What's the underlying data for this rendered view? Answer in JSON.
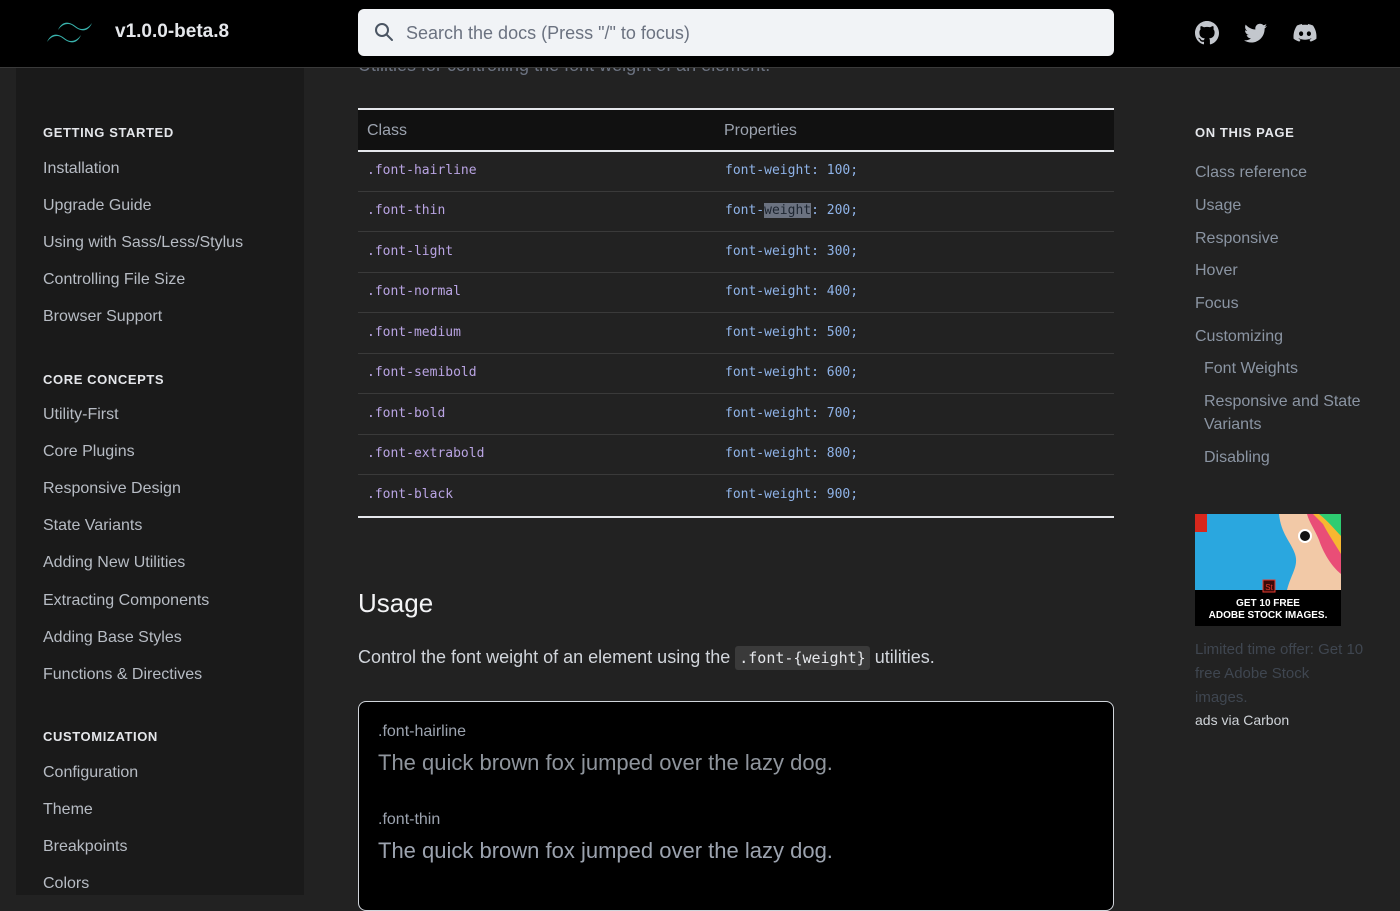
{
  "header": {
    "version": "v1.0.0-beta.8",
    "search_placeholder": "Search the docs (Press \"/\" to focus)",
    "social_icons": [
      "github-icon",
      "twitter-icon",
      "discord-icon"
    ]
  },
  "sidebar": {
    "sections": [
      {
        "title": "GETTING STARTED",
        "items": [
          "Installation",
          "Upgrade Guide",
          "Using with Sass/Less/Stylus",
          "Controlling File Size",
          "Browser Support"
        ]
      },
      {
        "title": "CORE CONCEPTS",
        "items": [
          "Utility-First",
          "Core Plugins",
          "Responsive Design",
          "State Variants",
          "Adding New Utilities",
          "Extracting Components",
          "Adding Base Styles",
          "Functions & Directives"
        ]
      },
      {
        "title": "CUSTOMIZATION",
        "items": [
          "Configuration",
          "Theme",
          "Breakpoints",
          "Colors"
        ]
      }
    ]
  },
  "main": {
    "subtitle": "Utilities for controlling the font weight of an element.",
    "table": {
      "headers": [
        "Class",
        "Properties"
      ],
      "rows": [
        {
          "cls": ".font-hairline",
          "prop": "font-weight: 100;"
        },
        {
          "cls": ".font-thin",
          "prop_a": "font-",
          "prop_hl": "weight",
          "prop_b": ": 200;"
        },
        {
          "cls": ".font-light",
          "prop": "font-weight: 300;"
        },
        {
          "cls": ".font-normal",
          "prop": "font-weight: 400;"
        },
        {
          "cls": ".font-medium",
          "prop": "font-weight: 500;"
        },
        {
          "cls": ".font-semibold",
          "prop": "font-weight: 600;"
        },
        {
          "cls": ".font-bold",
          "prop": "font-weight: 700;"
        },
        {
          "cls": ".font-extrabold",
          "prop": "font-weight: 800;"
        },
        {
          "cls": ".font-black",
          "prop": "font-weight: 900;"
        }
      ]
    },
    "usage": {
      "heading": "Usage",
      "text_before": "Control the font weight of an element using the ",
      "code": ".font-{weight}",
      "text_after": " utilities."
    },
    "demo": {
      "examples": [
        {
          "label": ".font-hairline",
          "text": "The quick brown fox jumped over the lazy dog."
        },
        {
          "label": ".font-thin",
          "text": "The quick brown fox jumped over the lazy dog."
        }
      ]
    }
  },
  "toc": {
    "title": "ON THIS PAGE",
    "items": [
      "Class reference",
      "Usage",
      "Responsive",
      "Hover",
      "Focus",
      "Customizing"
    ],
    "sub_items": [
      "Font Weights",
      "Responsive and State",
      "Variants",
      "Disabling"
    ]
  },
  "ad": {
    "headline_1": "GET 10 FREE",
    "headline_2": "ADOBE STOCK IMAGES.",
    "text": "Limited time offer: Get 10 free Adobe Stock images.",
    "via": "ads via Carbon"
  },
  "colors": {
    "accent_teal": "#38b2ac",
    "page_bg": "#222222",
    "sidebar_bg": "#1a1a1a",
    "class_color": "#b9a4e3",
    "prop_color": "#8fb3e8"
  }
}
